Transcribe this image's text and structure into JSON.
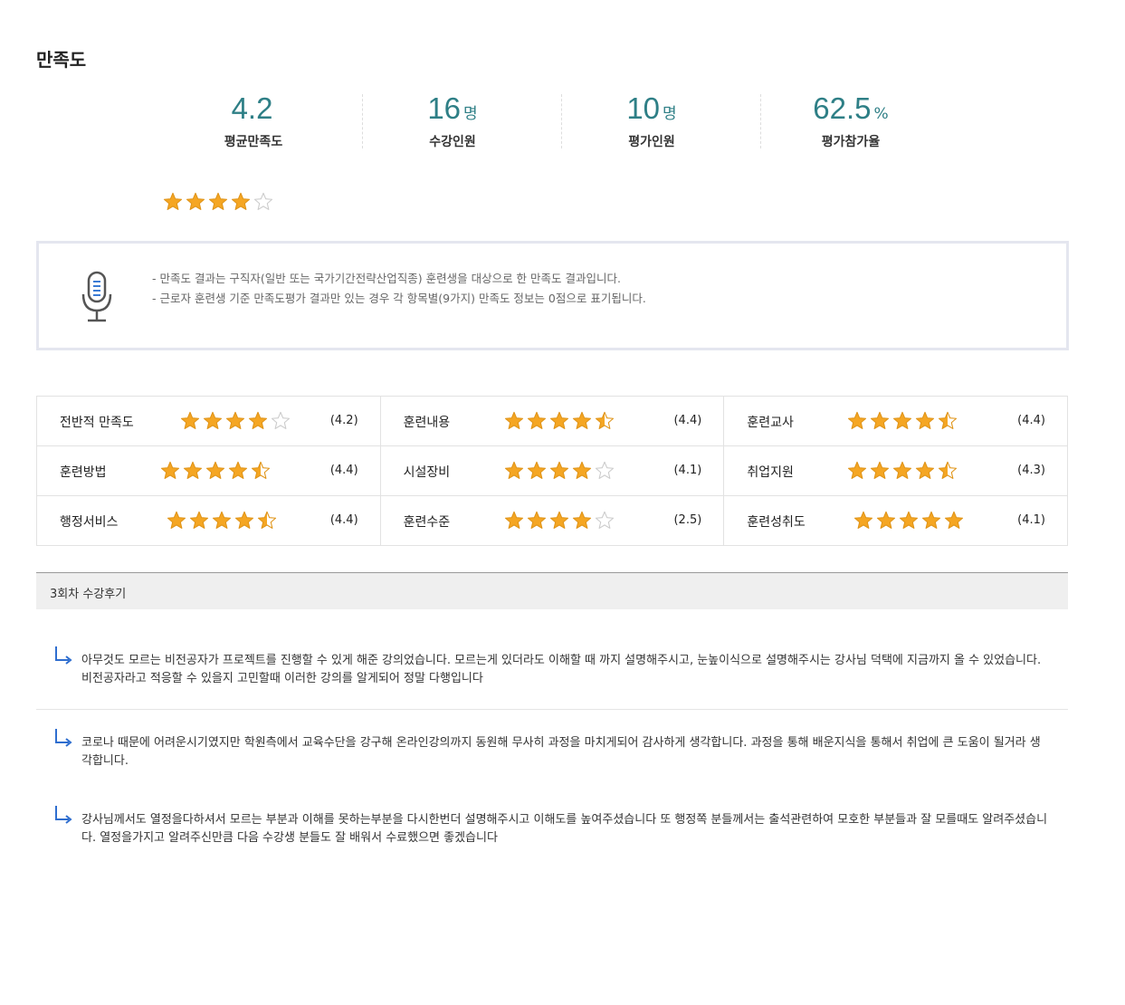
{
  "title": "만족도",
  "stats": [
    {
      "value": "4.2",
      "unit": "",
      "label": "평균만족도"
    },
    {
      "value": "16",
      "unit": "명",
      "label": "수강인원"
    },
    {
      "value": "10",
      "unit": "명",
      "label": "평가인원"
    },
    {
      "value": "62.5",
      "unit": "%",
      "label": "평가참가율"
    }
  ],
  "overall_stars": 4,
  "colors": {
    "accent": "#2e7f86",
    "star_fill": "#f5a623",
    "star_empty": "#cccccc",
    "arrow": "#2f6ecf"
  },
  "notice": {
    "icon": "microphone-icon",
    "lines": [
      "만족도 결과는 구직자(일반 또는 국가기간전략산업직종) 훈련생을 대상으로 한 만족도 결과입니다.",
      "근로자 훈련생 기준 만족도평가 결과만 있는 경우 각 항목별(9가지) 만족도 정보는 0점으로 표기됩니다."
    ]
  },
  "ratings": [
    {
      "name": "전반적 만족도",
      "stars": 4,
      "score": "(4.2)"
    },
    {
      "name": "훈련내용",
      "stars": 4.5,
      "score": "(4.4)"
    },
    {
      "name": "훈련교사",
      "stars": 4.5,
      "score": "(4.4)"
    },
    {
      "name": "훈련방법",
      "stars": 4.5,
      "score": "(4.4)"
    },
    {
      "name": "시설장비",
      "stars": 4,
      "score": "(4.1)"
    },
    {
      "name": "취업지원",
      "stars": 4.5,
      "score": "(4.3)"
    },
    {
      "name": "행정서비스",
      "stars": 4.5,
      "score": "(4.4)"
    },
    {
      "name": "훈련수준",
      "stars": 4,
      "score": "(2.5)"
    },
    {
      "name": "훈련성취도",
      "stars": 5,
      "score": "(4.1)"
    }
  ],
  "reviews_header": "3회차 수강후기",
  "reviews": [
    "아무것도 모르는 비전공자가 프로젝트를 진행할 수 있게 해준 강의었습니다. 모르는게 있더라도 이해할 때 까지 설명해주시고, 눈높이식으로 설명해주시는 강사님 덕택에 지금까지 올 수 있었습니다. 비전공자라고 적응할 수 있을지 고민할때 이러한 강의를 알게되어 정말 다행입니다",
    "코로나 때문에 어려운시기였지만 학원측에서 교육수단을 강구해 온라인강의까지 동원해 무사히 과정을 마치게되어 감사하게 생각합니다. 과정을 통해 배운지식을 통해서 취업에 큰 도움이 될거라 생각합니다.",
    "강사님께서도 열정을다하셔서 모르는 부분과 이해를 못하는부분을 다시한번더 설명해주시고 이해도를 높여주셨습니다 또 행정쪽 분들께서는 출석관련하여 모호한 부분들과 잘 모를때도 알려주셨습니다. 열정을가지고 알려주신만큼 다음 수강생 분들도 잘 배워서 수료했으면 좋겠습니다"
  ]
}
